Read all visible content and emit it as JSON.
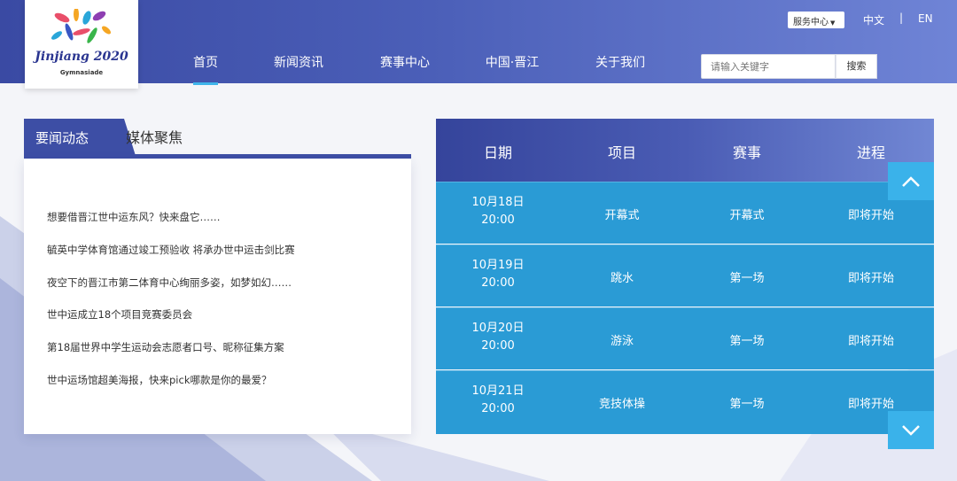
{
  "brand": {
    "title": "Jinjiang 2020",
    "subtitle": "Gymnasiade"
  },
  "nav": {
    "items": [
      {
        "label": "首页",
        "active": true
      },
      {
        "label": "新闻资讯",
        "active": false
      },
      {
        "label": "赛事中心",
        "active": false
      },
      {
        "label": "中国·晋江",
        "active": false
      },
      {
        "label": "关于我们",
        "active": false
      }
    ]
  },
  "topbar": {
    "service_select": "服务中心",
    "lang_zh": "中文",
    "lang_sep": "|",
    "lang_en": "EN"
  },
  "search": {
    "placeholder": "请输入关键字",
    "button": "搜索"
  },
  "news": {
    "tabs": [
      "要闻动态",
      "媒体聚焦"
    ],
    "active_tab": "要闻动态",
    "items": [
      "想要借晋江世中运东风？快来盘它……",
      "毓英中学体育馆通过竣工预验收 将承办世中运击剑比赛",
      "夜空下的晋江市第二体育中心绚丽多姿，如梦如幻……",
      "世中运成立18个项目竞赛委员会",
      "第18届世界中学生运动会志愿者口号、昵称征集方案",
      "世中运场馆超美海报，快来pick哪款是你的最爱？"
    ]
  },
  "schedule": {
    "headers": [
      "日期",
      "项目",
      "赛事",
      "进程"
    ],
    "rows": [
      {
        "date": "10月18日",
        "time": "20:00",
        "event": "开幕式",
        "match": "开幕式",
        "status": "即将开始"
      },
      {
        "date": "10月19日",
        "time": "20:00",
        "event": "跳水",
        "match": "第一场",
        "status": "即将开始"
      },
      {
        "date": "10月20日",
        "time": "20:00",
        "event": "游泳",
        "match": "第一场",
        "status": "即将开始"
      },
      {
        "date": "10月21日",
        "time": "20:00",
        "event": "竞技体操",
        "match": "第一场",
        "status": "即将开始"
      }
    ]
  },
  "colors": {
    "header_gradient_start": "#3a4aa3",
    "header_gradient_end": "#6f84d6",
    "tab_active": "#3d4ea5",
    "schedule_row": "#2a9bd5",
    "arrow_button": "#3ab2ea",
    "nav_underline": "#3fb4ea"
  },
  "icons": {
    "scroll_up": "chevron-up-icon",
    "scroll_down": "chevron-down-icon",
    "logo": "jinjiang-2020-logo"
  }
}
